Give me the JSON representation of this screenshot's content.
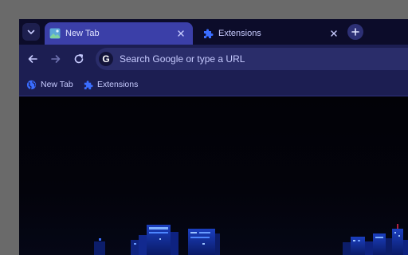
{
  "tabstrip": {
    "tabs": [
      {
        "label": "New Tab",
        "active": true,
        "favicon": "new-tab-favicon-icon"
      },
      {
        "label": "Extensions",
        "active": false,
        "favicon": "puzzle-icon"
      }
    ],
    "search_tabs_icon": "chevron-down-icon",
    "new_tab_icon": "plus-icon"
  },
  "toolbar": {
    "back_icon": "arrow-left-icon",
    "forward_icon": "arrow-right-icon",
    "reload_icon": "reload-icon",
    "omnibox": {
      "provider_icon_letter": "G",
      "placeholder": "Search Google or type a URL"
    }
  },
  "bookmarks": [
    {
      "label": "New Tab",
      "icon": "globe-icon"
    },
    {
      "label": "Extensions",
      "icon": "puzzle-icon"
    }
  ],
  "colors": {
    "tab_active": "#3b3fa8",
    "toolbar": "#1c1e52",
    "accent": "#3a6dff"
  }
}
